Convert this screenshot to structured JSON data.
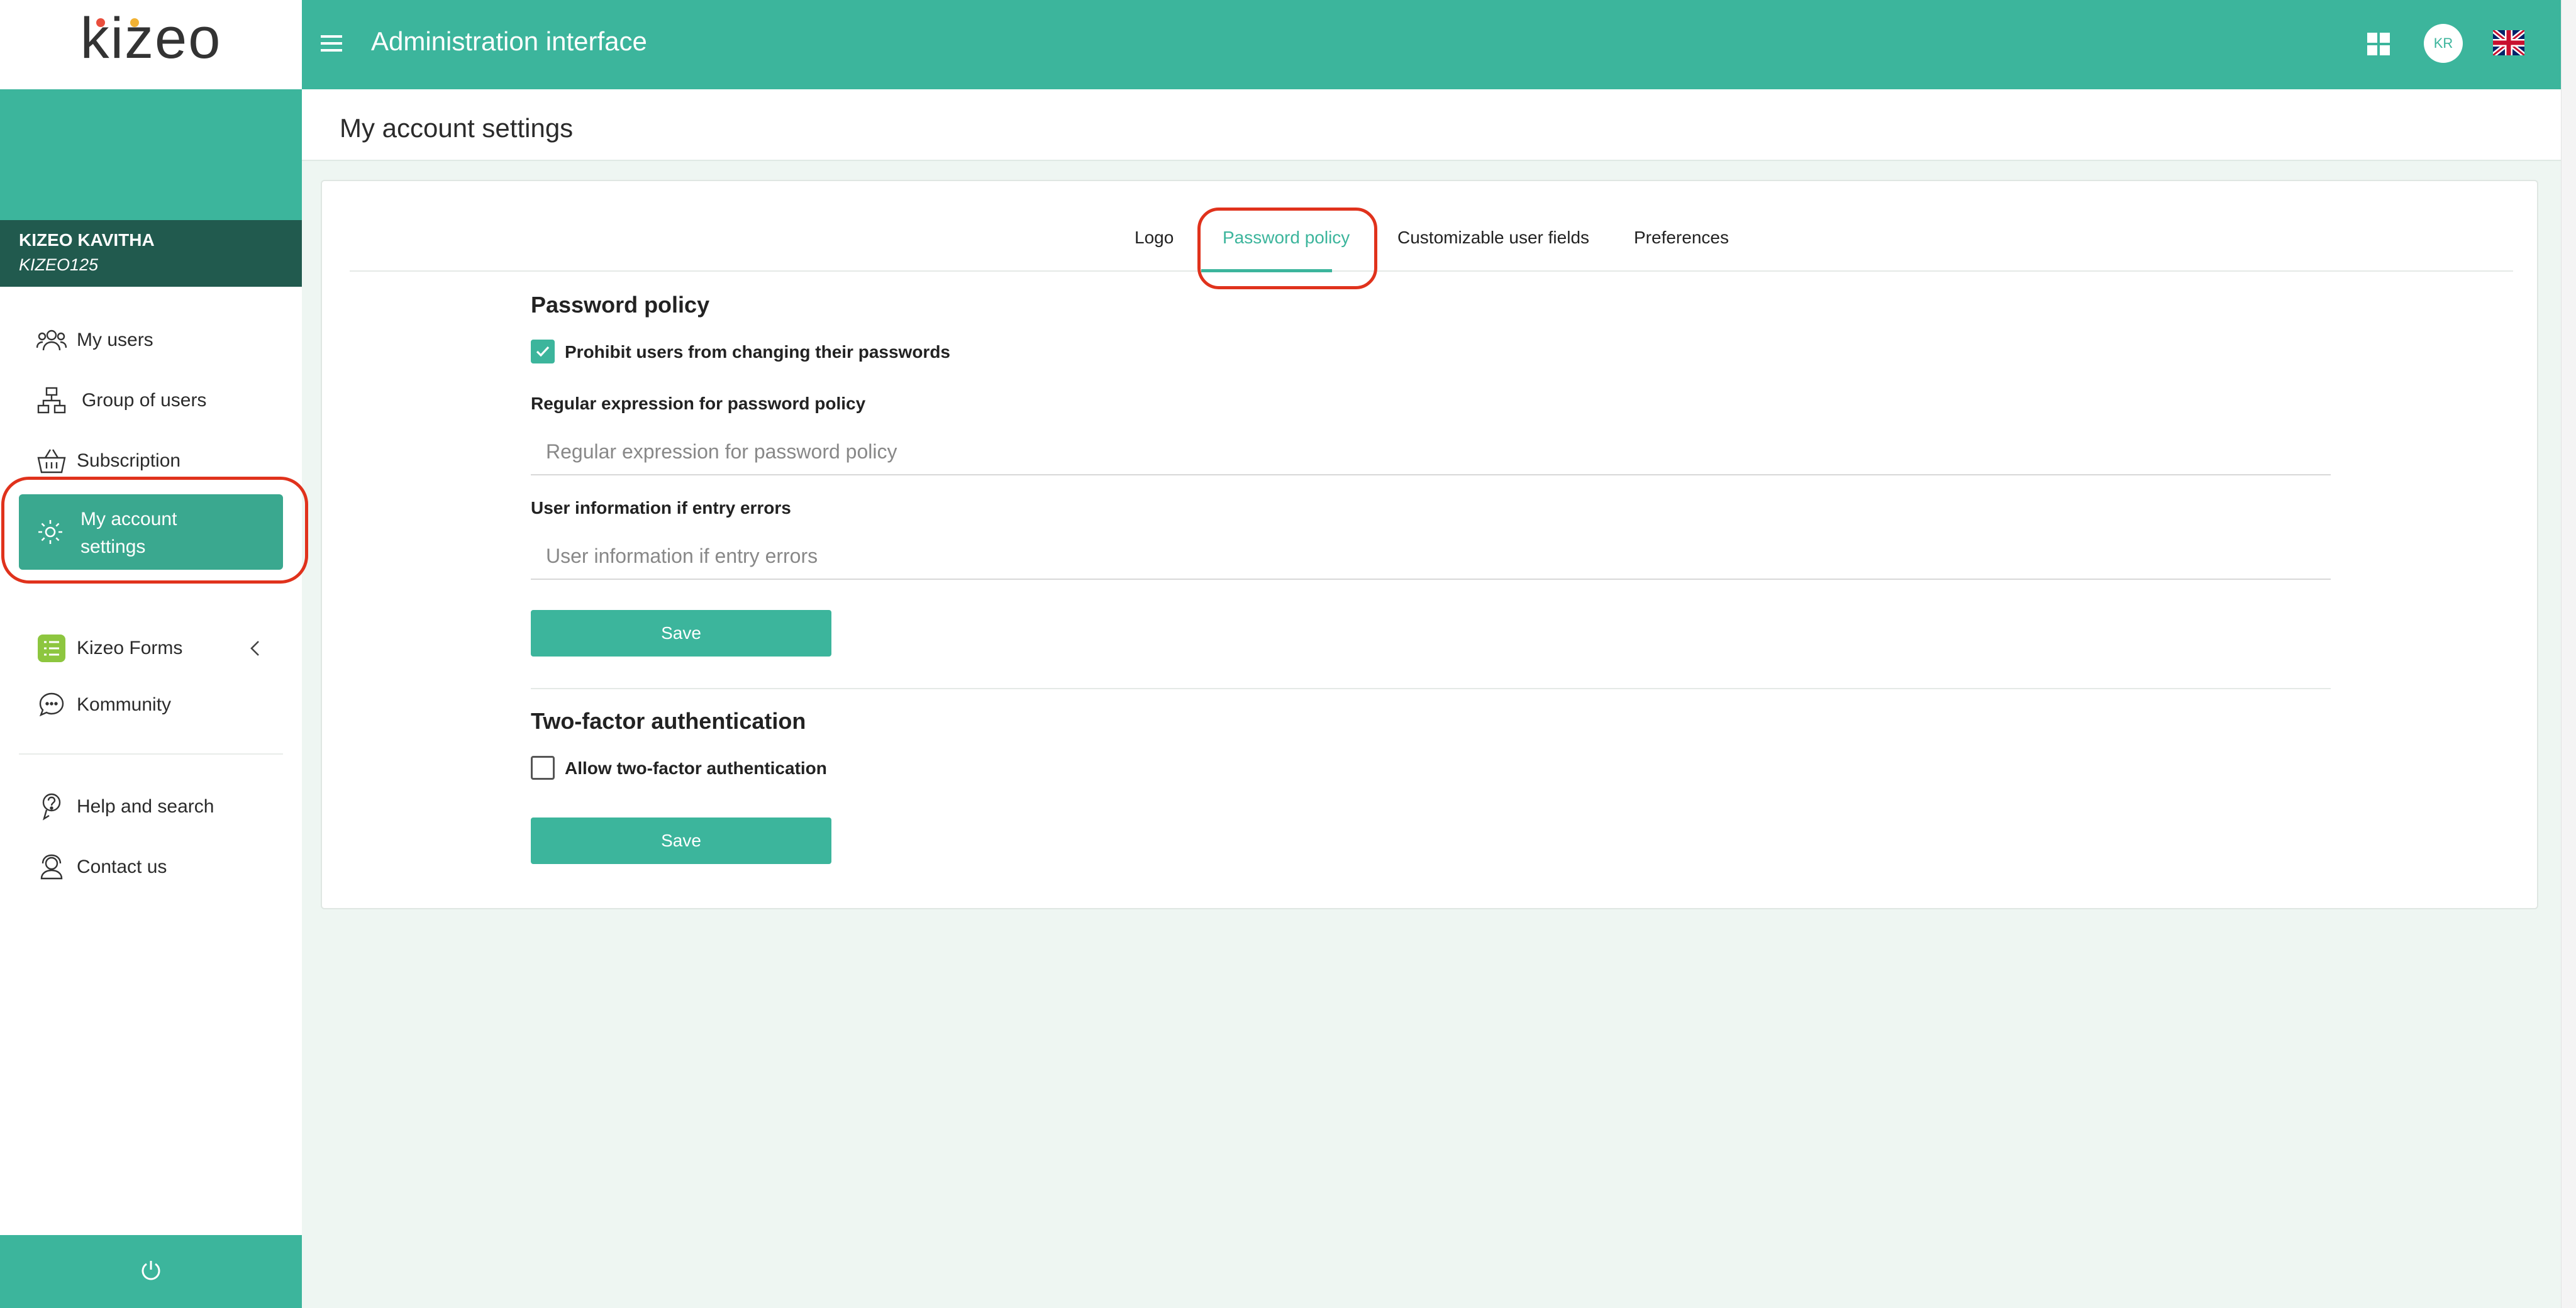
{
  "brand": {
    "logo_text": "kizeo",
    "accent": "#3cb59c",
    "dark": "#215a4e",
    "annotation": "#e0321c"
  },
  "header": {
    "title": "Administration interface",
    "avatar_initials": "KR"
  },
  "sidebar": {
    "user_name": "KIZEO KAVITHA",
    "user_code": "KIZEO125",
    "items": [
      {
        "label": "My users",
        "icon": "users-icon"
      },
      {
        "label": "Group of users",
        "icon": "hierarchy-icon"
      },
      {
        "label": "Subscription",
        "icon": "basket-icon"
      },
      {
        "label": "My account settings",
        "icon": "gear-icon",
        "active": true
      },
      {
        "label": "Kizeo Forms",
        "icon": "forms-app-icon"
      },
      {
        "label": "Kommunity",
        "icon": "chat-icon"
      },
      {
        "label": "Help and search",
        "icon": "help-icon"
      },
      {
        "label": "Contact us",
        "icon": "contact-icon"
      }
    ]
  },
  "page": {
    "title": "My account settings"
  },
  "tabs": [
    {
      "label": "Logo"
    },
    {
      "label": "Password policy",
      "active": true
    },
    {
      "label": "Customizable user fields"
    },
    {
      "label": "Preferences"
    }
  ],
  "password_policy": {
    "title": "Password policy",
    "prohibit_change_label": "Prohibit users from changing their passwords",
    "prohibit_change_checked": true,
    "regex_label": "Regular expression for password policy",
    "regex_placeholder": "Regular expression for password policy",
    "regex_value": "",
    "error_info_label": "User information if entry errors",
    "error_info_placeholder": "User information if entry errors",
    "error_info_value": "",
    "save_label": "Save"
  },
  "two_factor": {
    "title": "Two-factor authentication",
    "allow_label": "Allow two-factor authentication",
    "allow_checked": false,
    "save_label": "Save"
  }
}
